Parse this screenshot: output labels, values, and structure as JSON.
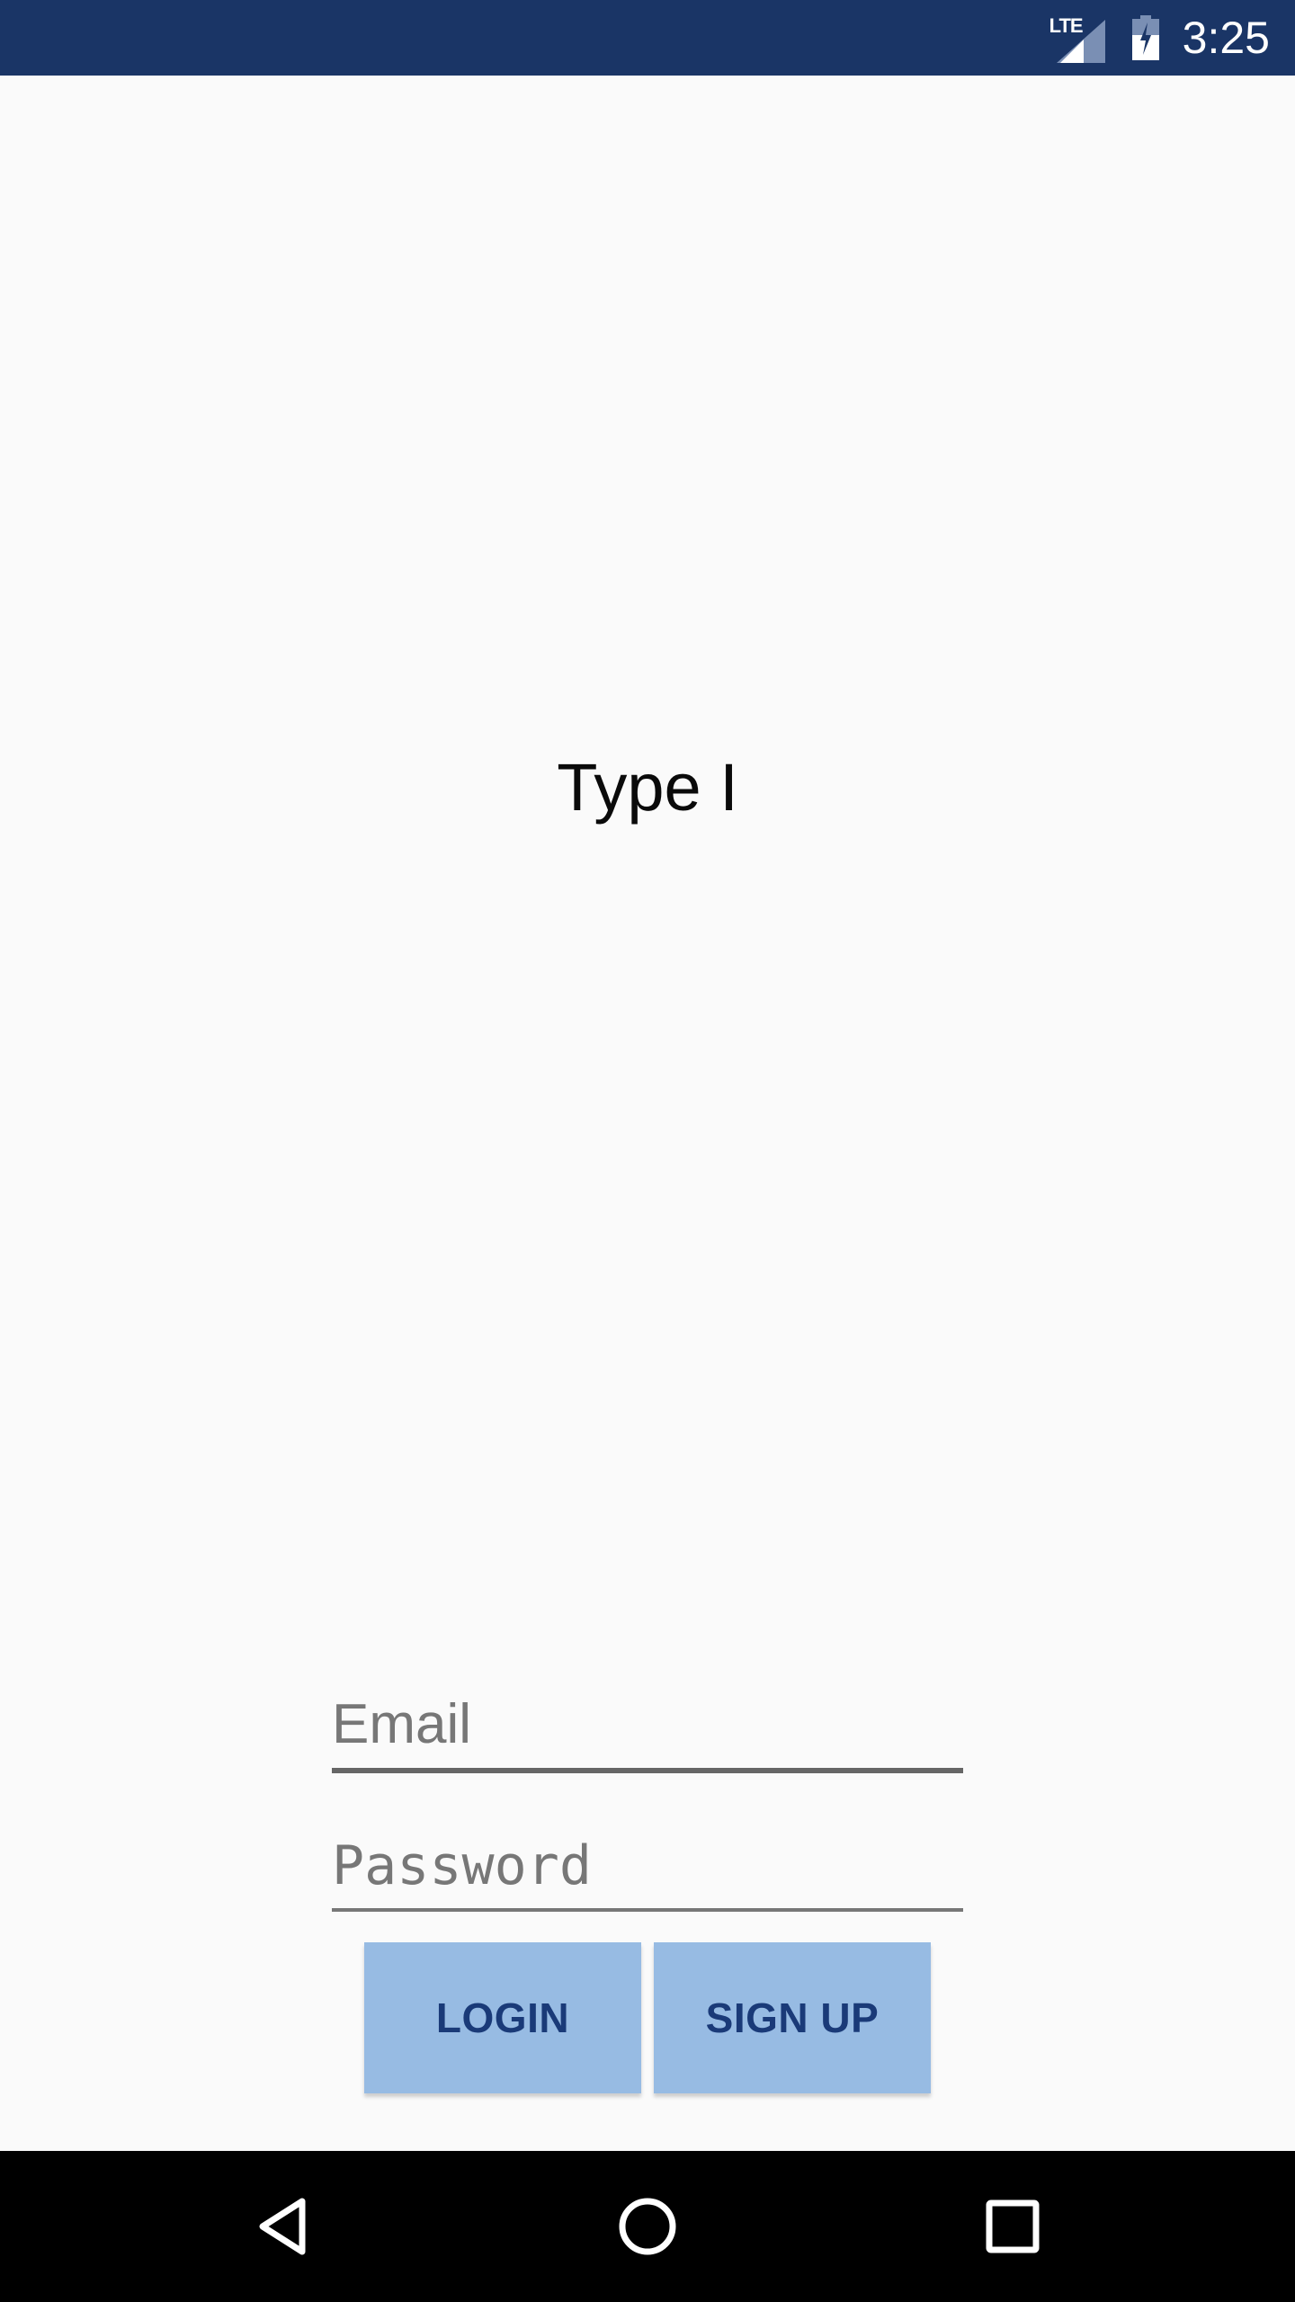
{
  "status_bar": {
    "network_label": "LTE",
    "time": "3:25",
    "background_color": "#1a3566"
  },
  "title": "Type I",
  "form": {
    "email_placeholder": "Email",
    "password_placeholder": "Password"
  },
  "buttons": {
    "login_label": "LOGIN",
    "signup_label": "SIGN UP",
    "background_color": "#97bbe3",
    "text_color": "#1a3a78"
  },
  "navigation": {
    "back_icon": "back-triangle-icon",
    "home_icon": "home-circle-icon",
    "recents_icon": "recents-square-icon"
  }
}
